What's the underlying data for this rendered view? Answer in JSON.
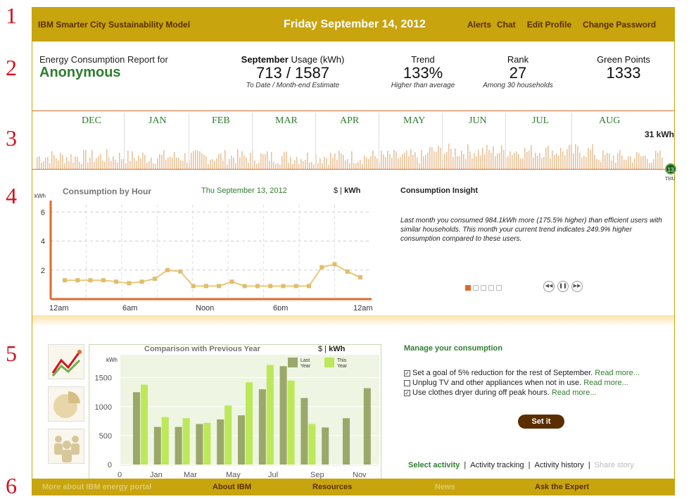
{
  "markers": [
    "1",
    "2",
    "3",
    "4",
    "5",
    "6"
  ],
  "header": {
    "brand": "IBM Smarter City Sustainability Model",
    "date": "Friday September 14, 2012",
    "links": [
      "Alerts",
      "Chat",
      "Edit Profile",
      "Change Password"
    ]
  },
  "report": {
    "label": "Energy Consumption Report for",
    "name": "Anonymous",
    "usage": {
      "month": "September",
      "label_rest": " Usage (kWh)",
      "value": "713 / 1587",
      "sub": "To Date /  Month-end Estimate"
    },
    "trend": {
      "label": "Trend",
      "value": "133%",
      "sub": "Higher than average"
    },
    "rank": {
      "label": "Rank",
      "value": "27",
      "sub": "Among 30 households"
    },
    "green": {
      "label": "Green Points",
      "value": "1333"
    }
  },
  "timeline": {
    "months": [
      "DEC",
      "JAN",
      "FEB",
      "MAR",
      "APR",
      "MAY",
      "JUN",
      "JUL",
      "AUG"
    ],
    "current_kwh": "31 kWh",
    "day": "13",
    "weekday": "THU",
    "color": "#e06a2a"
  },
  "hourly": {
    "title": "Consumption by Hour",
    "date": "Thu September 13, 2012",
    "toggle_dollar": "$",
    "toggle_sep": " | ",
    "toggle_kwh": "kWh",
    "chart_data": {
      "type": "line",
      "ylabel": "kWh",
      "yticks": [
        2,
        4,
        6
      ],
      "xticks": [
        "12am",
        "6am",
        "Noon",
        "6pm",
        "12am"
      ],
      "ylim": [
        0,
        6.5
      ],
      "values": [
        1.3,
        1.3,
        1.3,
        1.3,
        1.2,
        1.1,
        1.2,
        1.4,
        2.0,
        1.9,
        0.9,
        0.9,
        0.9,
        1.2,
        0.9,
        0.9,
        0.9,
        0.9,
        0.9,
        0.9,
        2.2,
        2.4,
        1.9,
        1.5
      ]
    }
  },
  "insight": {
    "title": "Consumption Insight",
    "text": "Last month you consumed 984.1kWh more (175.5% higher) than efficient users with similar households. This month your current trend indicates 249.9% higher consumption compared to these users.",
    "pages": 5,
    "active_page": 1,
    "controls": [
      "rewind-icon",
      "pause-icon",
      "forward-icon"
    ]
  },
  "comparison": {
    "title": "Comparison with Previous Year",
    "toggle_dollar": "$",
    "toggle_sep": " | ",
    "toggle_kwh": "kWh",
    "chart_data": {
      "type": "bar",
      "ylabel": "kWh",
      "ylim": [
        0,
        1800
      ],
      "yticks": [
        0,
        500,
        1000,
        1500
      ],
      "xticks": [
        "0",
        "Jan",
        "Mar",
        "May",
        "Jul",
        "Sep",
        "Nov"
      ],
      "categories": [
        "Jan",
        "Feb",
        "Mar",
        "Apr",
        "May",
        "Jun",
        "Jul",
        "Aug",
        "Sep",
        "Oct",
        "Nov",
        "Dec"
      ],
      "series": [
        {
          "name": "Last Year",
          "color": "#9aa86a",
          "values": [
            1250,
            650,
            650,
            700,
            780,
            850,
            1300,
            1700,
            1150,
            640,
            800,
            1320
          ]
        },
        {
          "name": "This Year",
          "color": "#bce85a",
          "values": [
            1380,
            820,
            800,
            720,
            1020,
            1420,
            1720,
            1450,
            700,
            null,
            null,
            null
          ]
        }
      ],
      "legend": [
        "Last\nYear",
        "This\nYear"
      ]
    }
  },
  "manage": {
    "title": "Manage your consumption",
    "tips": [
      {
        "checked": true,
        "text": "Set a goal of 5% reduction for the rest of September.",
        "link": "Read more..."
      },
      {
        "checked": false,
        "text": "Unplug TV and other appliances when not in use.",
        "link": "Read more..."
      },
      {
        "checked": true,
        "text": "Use clothes dryer during off peak hours.",
        "link": "Read more..."
      }
    ],
    "button": "Set it"
  },
  "tabs": [
    "Select activity",
    "Activity tracking",
    "Activity history",
    "Share story"
  ],
  "footer": [
    "More about IBM energy portal",
    "About IBM",
    "Resources",
    "News",
    "Ask the Expert"
  ]
}
